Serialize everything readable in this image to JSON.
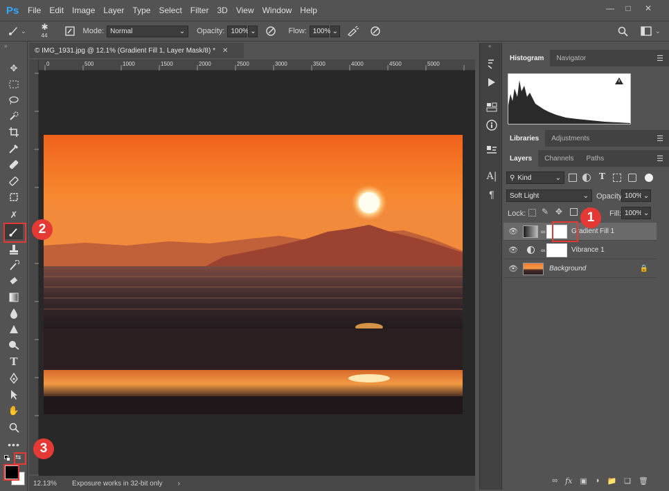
{
  "app": {
    "logo_text": "Ps"
  },
  "menu": [
    "File",
    "Edit",
    "Image",
    "Layer",
    "Type",
    "Select",
    "Filter",
    "3D",
    "View",
    "Window",
    "Help"
  ],
  "options_bar": {
    "brush_size": "44",
    "mode_label": "Mode:",
    "mode_value": "Normal",
    "opacity_label": "Opacity:",
    "opacity_value": "100%",
    "flow_label": "Flow:",
    "flow_value": "100%"
  },
  "document": {
    "tab_title": "© IMG_1931.jpg @ 12.1% (Gradient Fill 1, Layer Mask/8) *",
    "ruler_ticks": [
      "0",
      "500",
      "1000",
      "1500",
      "2000",
      "2500",
      "3000",
      "3500",
      "4000",
      "4500",
      "5000"
    ],
    "zoom": "12.13%",
    "status_text": "Exposure works in 32-bit only"
  },
  "panels": {
    "top_tabs": [
      "Histogram",
      "Navigator"
    ],
    "mid_tabs": [
      "Libraries",
      "Adjustments"
    ],
    "layer_tabs": [
      "Layers",
      "Channels",
      "Paths"
    ],
    "kind_filter": "Kind",
    "blend_mode": "Soft Light",
    "opacity_label": "Opacity:",
    "opacity_value": "100%",
    "lock_label": "Lock:",
    "fill_label": "Fill:",
    "fill_value": "100%"
  },
  "layers": [
    {
      "name": "Gradient Fill 1",
      "selected": true
    },
    {
      "name": "Vibrance 1",
      "selected": false
    },
    {
      "name": "Background",
      "selected": false,
      "italic": true
    }
  ],
  "callouts": [
    "1",
    "2",
    "3"
  ],
  "colors": {
    "accent": "#31a8ff",
    "callout": "#e53935",
    "selected_layer": "#6a6a6a"
  }
}
